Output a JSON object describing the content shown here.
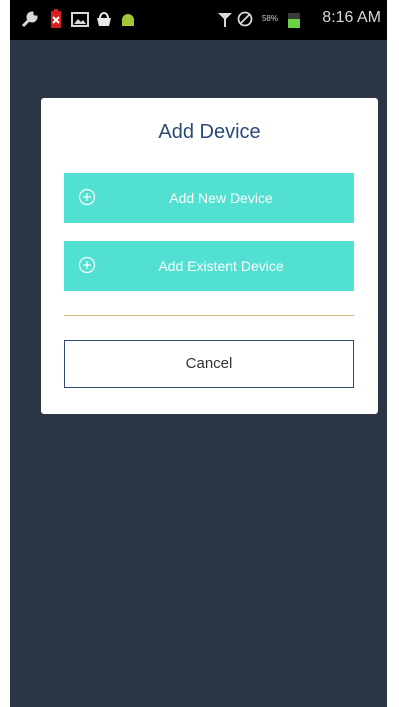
{
  "status_bar": {
    "time": "8:16 AM",
    "battery_percent": "58%",
    "left_icons": [
      "wrench-icon",
      "battery-alert-icon",
      "gallery-icon",
      "basket-icon",
      "android-icon"
    ],
    "right_icons": [
      "signal-icon",
      "no-sim-icon",
      "battery-icon"
    ]
  },
  "dialog": {
    "title": "Add Device",
    "actions": [
      {
        "label": "Add New Device",
        "icon": "plus-circle-icon"
      },
      {
        "label": "Add Existent Device",
        "icon": "plus-circle-icon"
      }
    ],
    "cancel_label": "Cancel"
  },
  "colors": {
    "background": "#2b3544",
    "accent": "#52e0d3",
    "title": "#2c4a78",
    "divider": "#d8b87a"
  }
}
